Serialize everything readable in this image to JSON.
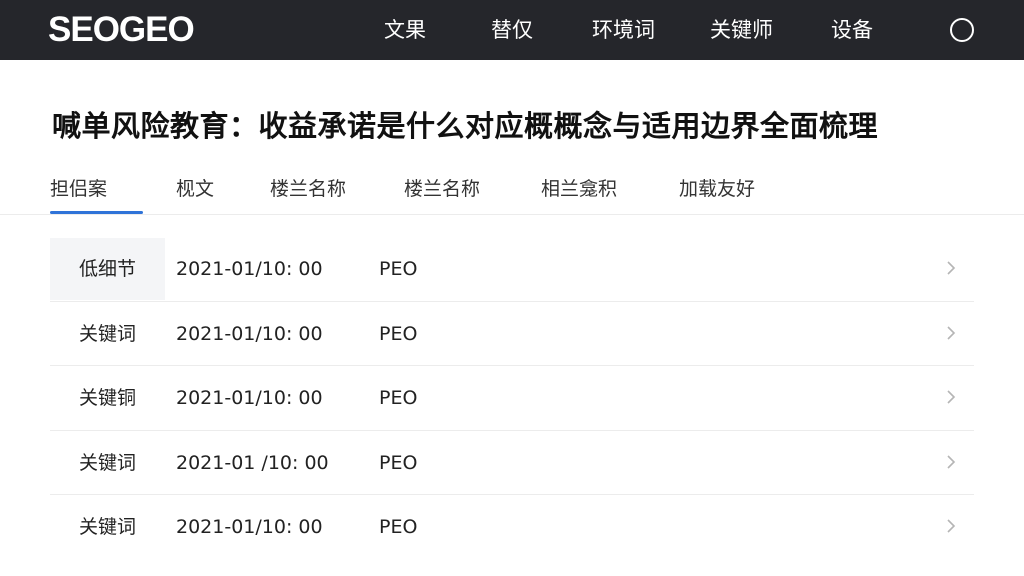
{
  "header": {
    "logo": "SEOGEO",
    "nav": [
      {
        "label": "文果"
      },
      {
        "label": "替仅"
      },
      {
        "label": "环境词"
      },
      {
        "label": "关键师"
      },
      {
        "label": "设备"
      }
    ],
    "user_icon": "user-circle-icon"
  },
  "page": {
    "title": "喊单风险教育：收益承诺是什么对应概概念与适用边界全面梳理"
  },
  "tabs": [
    {
      "label": "担侣案",
      "active": true
    },
    {
      "label": "枧文",
      "active": false
    },
    {
      "label": "楼兰名称",
      "active": false
    },
    {
      "label": "楼兰名称",
      "active": false
    },
    {
      "label": "相兰龛积",
      "active": false
    },
    {
      "label": "加载友好",
      "active": false
    }
  ],
  "list": {
    "rows": [
      {
        "label": "低细节",
        "date": "2021-01/10: 00",
        "code": "PEO"
      },
      {
        "label": "关键词",
        "date": "2021-01/10: 00",
        "code": "PEO"
      },
      {
        "label": "关键铜",
        "date": "2021-01/10: 00",
        "code": "PEO"
      },
      {
        "label": "关键词",
        "date": "2021-01 /10: 00",
        "code": "PEO"
      },
      {
        "label": "关键词",
        "date": "2021-01/10: 00",
        "code": "PEO"
      }
    ]
  },
  "colors": {
    "topbar": "#25262b",
    "accent": "#2f73d8"
  }
}
